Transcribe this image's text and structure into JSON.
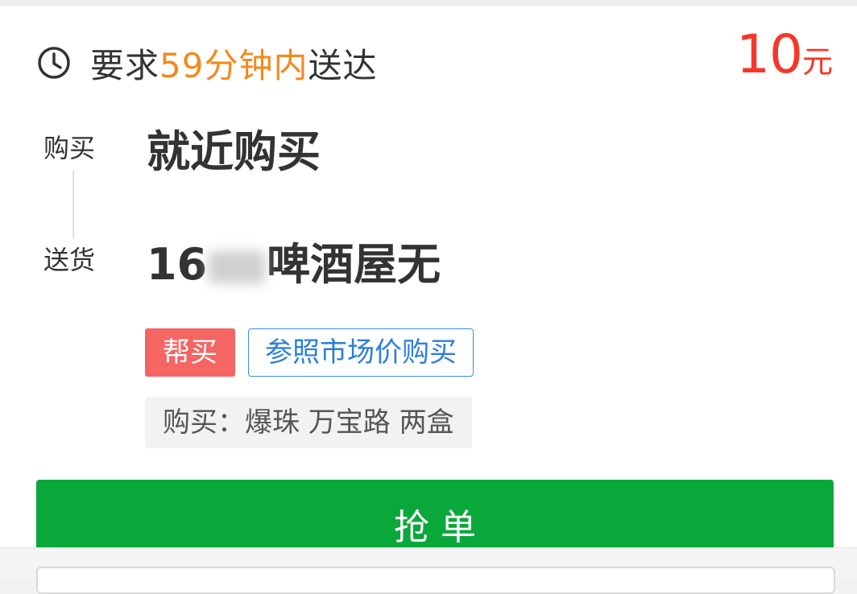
{
  "order": {
    "deadline": {
      "prefix": "要求",
      "highlight": "59分钟内",
      "suffix": "送达",
      "icon": "clock-icon"
    },
    "price": {
      "amount": "10",
      "unit": "元"
    },
    "route": {
      "buy_label": "购买",
      "buy_value": "就近购买",
      "deliver_label": "送货",
      "deliver_value_prefix": "16",
      "deliver_value_suffix": "啤酒屋无"
    },
    "tags": {
      "type": "帮买",
      "pricing": "参照市场价购买"
    },
    "note": "购买：爆珠 万宝路 两盒",
    "grab_button": "抢单"
  },
  "colors": {
    "accent_orange": "#f28a1b",
    "price_red": "#f5372b",
    "tag_red": "#f46563",
    "tag_blue": "#2b7fd9",
    "button_green": "#0aa83a"
  }
}
